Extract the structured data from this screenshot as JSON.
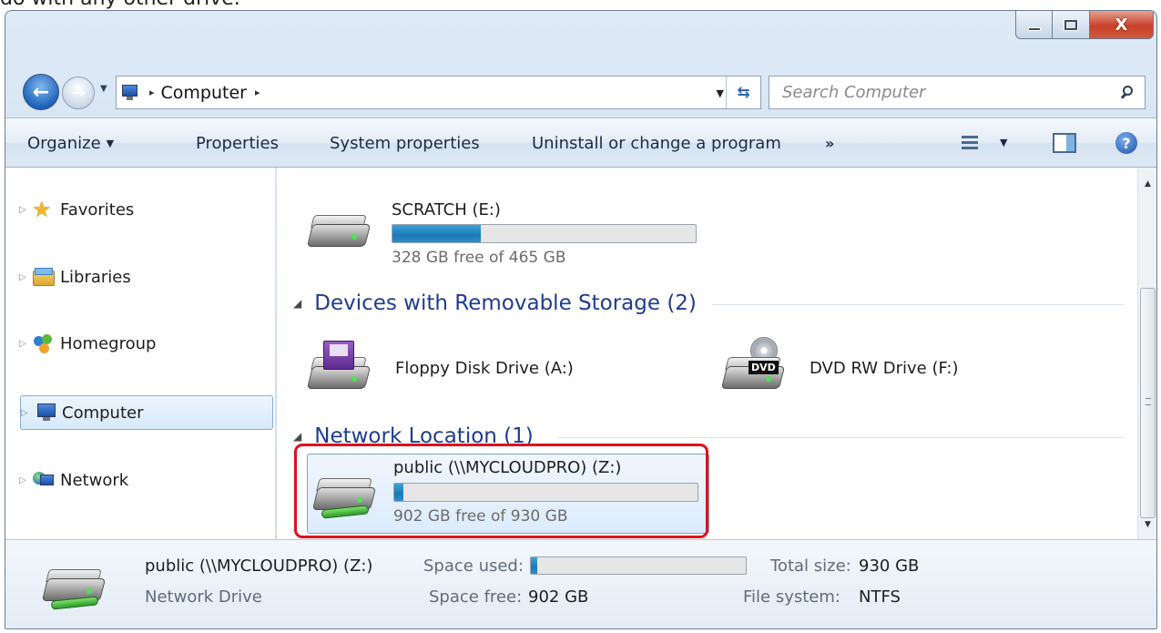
{
  "page_caption": "do with any other drive.",
  "titlebar": {
    "minimize": "—",
    "maximize": "□",
    "close": "X"
  },
  "address": {
    "location": "Computer",
    "separator": "▸",
    "trail": "▸",
    "dropdown": "▼",
    "refresh": "⇆"
  },
  "search": {
    "placeholder": "Search Computer"
  },
  "command_bar": {
    "organize": "Organize",
    "properties": "Properties",
    "system_properties": "System properties",
    "uninstall": "Uninstall or change a program",
    "more": "»",
    "caret": "▼",
    "help": "?"
  },
  "nav": {
    "expander": "▷",
    "items": [
      {
        "label": "Favorites"
      },
      {
        "label": "Libraries"
      },
      {
        "label": "Homegroup"
      },
      {
        "label": "Computer"
      },
      {
        "label": "Network"
      }
    ]
  },
  "content": {
    "scratch": {
      "name": "SCRATCH (E:)",
      "info": "328 GB free of 465 GB",
      "used_fraction": 0.29
    },
    "removable_header": "Devices with Removable Storage (2)",
    "floppy": {
      "name": "Floppy Disk Drive (A:)"
    },
    "dvd": {
      "name": "DVD RW Drive (F:)",
      "badge": "DVD"
    },
    "network_header": "Network Location (1)",
    "network": {
      "name": "public (\\\\MYCLOUDPRO) (Z:)",
      "info": "902 GB free of 930 GB",
      "used_fraction": 0.03
    },
    "collapse_glyph": "◢"
  },
  "scrollbar": {
    "up": "▲",
    "down": "▼"
  },
  "details": {
    "name": "public (\\\\MYCLOUDPRO) (Z:)",
    "type": "Network Drive",
    "space_used_label": "Space used:",
    "space_used_fraction": 0.03,
    "space_free_label": "Space free:",
    "space_free_value": "902 GB",
    "total_size_label": "Total size:",
    "total_size_value": "930 GB",
    "file_system_label": "File system:",
    "file_system_value": "NTFS"
  }
}
